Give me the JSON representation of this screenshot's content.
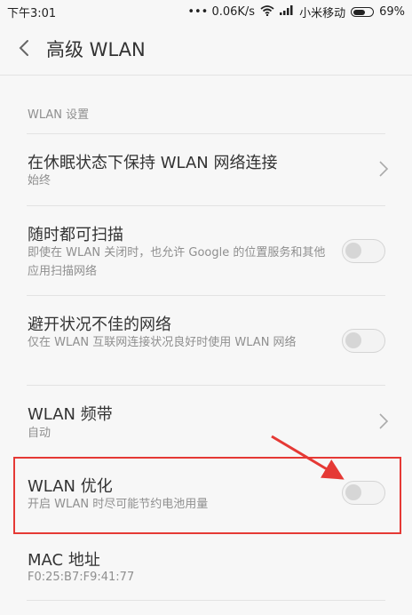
{
  "status_bar": {
    "time": "下午3:01",
    "speed": "••• 0.06K/s",
    "carrier": "小米移动",
    "battery": "69%",
    "battery_level": 0.69
  },
  "header": {
    "title": "高级 WLAN",
    "back_icon": "chevron-left-icon"
  },
  "section": {
    "title": "WLAN 设置"
  },
  "items": [
    {
      "title": "在休眠状态下保持 WLAN 网络连接",
      "subtitle": "始终",
      "control": "chevron"
    },
    {
      "title": "随时都可扫描",
      "subtitle": "即使在 WLAN 关闭时，也允许 Google 的位置服务和其他应用扫描网络",
      "control": "toggle",
      "enabled": false
    },
    {
      "title": "避开状况不佳的网络",
      "subtitle": "仅在 WLAN 互联网连接状况良好时使用 WLAN 网络",
      "control": "toggle",
      "enabled": false
    },
    {
      "title": "WLAN 频带",
      "subtitle": "自动",
      "control": "chevron"
    },
    {
      "title": "WLAN 优化",
      "subtitle": "开启 WLAN 时尽可能节约电池用量",
      "control": "toggle",
      "enabled": false
    },
    {
      "title": "MAC 地址",
      "subtitle": "F0:25:B7:F9:41:77",
      "control": "none"
    }
  ],
  "annotation": {
    "highlight_color": "#e53935"
  }
}
